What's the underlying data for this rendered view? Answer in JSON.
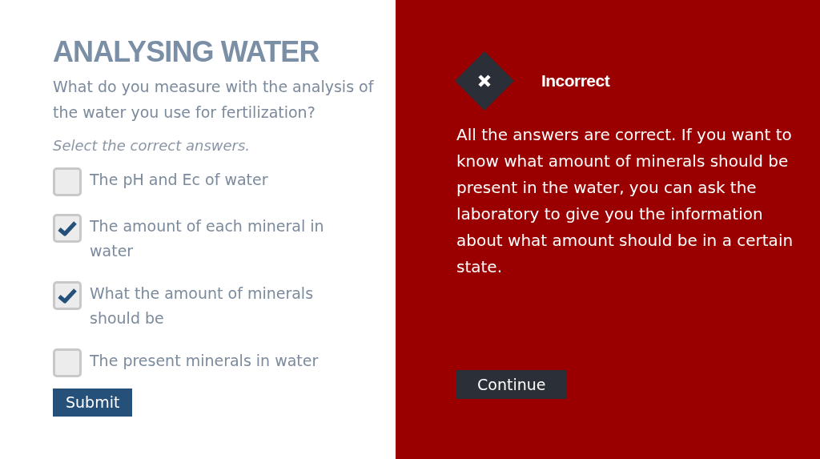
{
  "title": "ANALYSING WATER",
  "question": "What do you measure with the analysis of the water you use for fertilization?",
  "instruction": "Select the correct answers.",
  "options": [
    {
      "label": "The pH and Ec of water",
      "checked": false
    },
    {
      "label": "The amount of each mineral in water",
      "checked": true
    },
    {
      "label": "What the amount of minerals should be",
      "checked": true
    },
    {
      "label": "The present minerals in water",
      "checked": false
    }
  ],
  "submit": "Submit",
  "feedback": {
    "kind": "incorrect",
    "heading": "Incorrect",
    "text": "All the answers are correct. If you want to know what amount of minerals should be present in the water, you can ask the laboratory to give you the information about what amount should be in a certain state.",
    "button": "Continue"
  }
}
